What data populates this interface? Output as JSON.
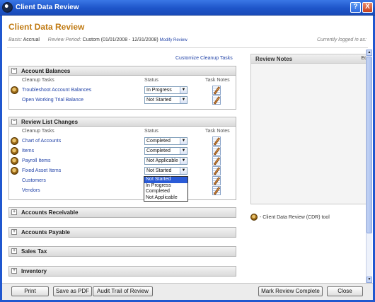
{
  "window": {
    "title": "Client Data Review",
    "help": "?",
    "close": "X"
  },
  "header": {
    "title": "Client Data Review",
    "basis_label": "Basis:",
    "basis_value": "Accrual",
    "period_label": "Review Period:",
    "period_value": "Custom (01/01/2008 - 12/31/2008)",
    "modify_link": "Modify Review",
    "logged_in": "Currently logged in as:"
  },
  "customize_link": "Customize Cleanup Tasks",
  "columns": {
    "tasks": "Cleanup Tasks",
    "status": "Status",
    "notes": "Task Notes"
  },
  "account_balances": {
    "title": "Account Balances",
    "toggle": "−",
    "rows": [
      {
        "task": "Troubleshoot Account Balances",
        "status": "In Progress"
      },
      {
        "task": "Open Working Trial Balance",
        "status": "Not Started"
      }
    ]
  },
  "review_list_changes": {
    "title": "Review List Changes",
    "toggle": "−",
    "rows": [
      {
        "task": "Chart of Accounts",
        "status": "Completed"
      },
      {
        "task": "Items",
        "status": "Completed"
      },
      {
        "task": "Payroll Items",
        "status": "Not Applicable"
      },
      {
        "task": "Fixed Asset Items",
        "status": "Not Started"
      },
      {
        "task": "Customers",
        "status": ""
      },
      {
        "task": "Vendors",
        "status": ""
      }
    ]
  },
  "dropdown_options": [
    "Not Started",
    "In Progress",
    "Completed",
    "Not Applicable"
  ],
  "collapsed_panels": [
    {
      "title": "Accounts Receivable",
      "toggle": "+"
    },
    {
      "title": "Accounts Payable",
      "toggle": "+"
    },
    {
      "title": "Sales Tax",
      "toggle": "+"
    },
    {
      "title": "Inventory",
      "toggle": "+"
    }
  ],
  "review_notes": {
    "title": "Review Notes",
    "edit": "Ed"
  },
  "legend_text": "- Client Data Review (CDR) tool",
  "footer": {
    "print": "Print",
    "save_pdf": "Save as PDF",
    "audit_trail": "Audit Trail of Review",
    "mark_complete": "Mark Review Complete",
    "close": "Close"
  },
  "arrow_glyph": "▼"
}
